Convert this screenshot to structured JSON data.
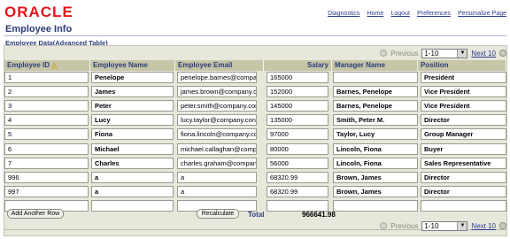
{
  "brand": "ORACLE",
  "top_links": [
    "Diagnostics",
    "Home",
    "Logout",
    "Preferences",
    "Personalize Page"
  ],
  "page_title": "Employee Info",
  "section_title": "Employee Data(Advanced Table)",
  "nav": {
    "previous": "Previous",
    "range": "1-10",
    "next": "Next 10"
  },
  "columns": [
    "Employee ID",
    "Employee Name",
    "Employee Email",
    "Salary",
    "Manager Name",
    "Position"
  ],
  "rows": [
    {
      "id": "1",
      "name": "Penelope",
      "email": "penelope.barnes@compar",
      "salary": "165000",
      "manager": "",
      "position": "President"
    },
    {
      "id": "2",
      "name": "James",
      "email": "james.brown@company.co",
      "salary": "152000",
      "manager": "Barnes, Penelope",
      "position": "Vice President"
    },
    {
      "id": "3",
      "name": "Peter",
      "email": "peter.smith@company.con",
      "salary": "145000",
      "manager": "Barnes, Penelope",
      "position": "Vice President"
    },
    {
      "id": "4",
      "name": "Lucy",
      "email": "lucy.taylor@company.con",
      "salary": "135000",
      "manager": "Smith, Peter M.",
      "position": "Director"
    },
    {
      "id": "5",
      "name": "Fiona",
      "email": "fiona.lincoln@company.cc",
      "salary": "97000",
      "manager": "Taylor, Lucy",
      "position": "Group Manager"
    },
    {
      "id": "6",
      "name": "Michael",
      "email": "michael.callaghan@comp",
      "salary": "80000",
      "manager": "Lincoln, Fiona",
      "position": "Buyer"
    },
    {
      "id": "7",
      "name": "Charles",
      "email": "charles.graham@compan",
      "salary": "56000",
      "manager": "Lincoln, Fiona",
      "position": "Sales Representative"
    },
    {
      "id": "996",
      "name": "a",
      "email": "a",
      "salary": "68320.99",
      "manager": "Brown, James",
      "position": "Director"
    },
    {
      "id": "997",
      "name": "a",
      "email": "a",
      "salary": "68320.99",
      "manager": "Brown, James",
      "position": "Director"
    },
    {
      "id": "",
      "name": "",
      "email": "",
      "salary": "",
      "manager": "",
      "position": ""
    }
  ],
  "add_row_label": "Add Another Row",
  "recalculate_label": "Recalculate",
  "total_label": "Total",
  "total_value": "966641.98",
  "colors": {
    "brand_red": "#e3151a",
    "header_bg": "#c6c5a8",
    "link_blue": "#2b3e8f",
    "title_blue": "#2c3f7a"
  }
}
